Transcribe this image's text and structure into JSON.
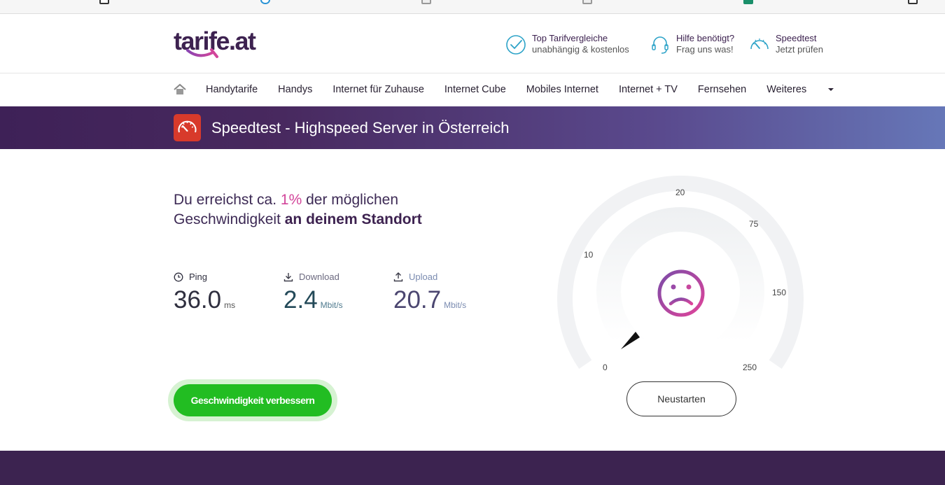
{
  "header": {
    "logo_text": "tarife.at",
    "items": [
      {
        "line1": "Top Tarifvergleiche",
        "line2": "unabhängig & kostenlos",
        "icon": "check-circle-icon"
      },
      {
        "line1": "Hilfe benötigt?",
        "line2": "Frag uns was!",
        "icon": "headset-icon"
      },
      {
        "line1": "Speedtest",
        "line2": "Jetzt prüfen",
        "icon": "speedometer-icon"
      }
    ]
  },
  "nav": {
    "home_icon": "home-icon",
    "items": [
      "Handytarife",
      "Handys",
      "Internet für Zuhause",
      "Internet Cube",
      "Mobiles Internet",
      "Internet + TV",
      "Fernsehen",
      "Weiteres"
    ]
  },
  "banner": {
    "title": "Speedtest - Highspeed Server in Österreich",
    "icon": "speedometer-icon"
  },
  "result": {
    "prefix": "Du erreichst ca.",
    "percent": "1%",
    "middle": "der möglichen Geschwindigkeit",
    "suffix": "an deinem Standort"
  },
  "metrics": {
    "ping": {
      "label": "Ping",
      "value": "36.0",
      "unit": "ms",
      "icon": "clock-icon"
    },
    "download": {
      "label": "Download",
      "value": "2.4",
      "unit": "Mbit/s",
      "icon": "download-icon"
    },
    "upload": {
      "label": "Upload",
      "value": "20.7",
      "unit": "Mbit/s",
      "icon": "upload-icon"
    }
  },
  "buttons": {
    "improve": "Geschwindigkeit verbessern",
    "restart": "Neustarten"
  },
  "gauge": {
    "labels": [
      "0",
      "10",
      "20",
      "75",
      "150",
      "250"
    ],
    "face_icon": "sad-face-icon",
    "colors": {
      "face_start": "#7b4ba8",
      "face_end": "#e0449a",
      "track": "#f1f2f4"
    }
  },
  "colors": {
    "brand": "#3d2250",
    "accent": "#d2459a",
    "button_green": "#22bd22"
  }
}
